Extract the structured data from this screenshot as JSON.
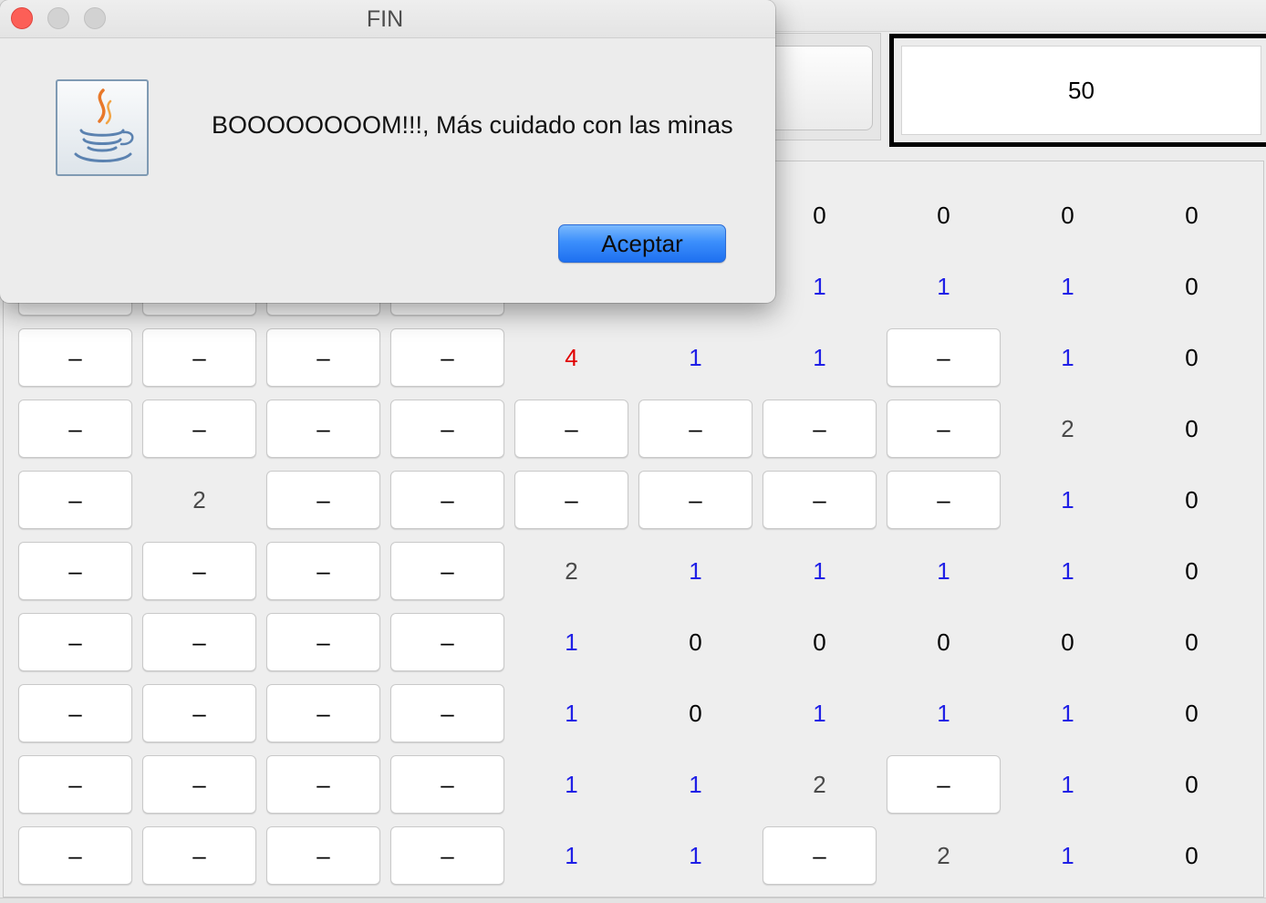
{
  "dialog": {
    "title": "FIN",
    "message": "BOOOOOOOOM!!!, Más cuidado con las minas",
    "ok_label": "Aceptar",
    "icon": "java-coffee-icon"
  },
  "header": {
    "counter": "50"
  },
  "colors": {
    "numbers": {
      "0": "#000000",
      "1": "#1f1fe6",
      "2": "#4a4a4a",
      "4": "#e00000"
    },
    "close_light": "#fc5f57",
    "accept_button": "#3c8ffc"
  },
  "board": {
    "rows": [
      [
        null,
        null,
        null,
        null,
        null,
        null,
        "0",
        "0",
        "0",
        "0"
      ],
      [
        {
          "covered": true
        },
        {
          "covered": true
        },
        {
          "covered": true
        },
        {
          "covered": true
        },
        null,
        null,
        "1",
        "1",
        "1",
        "0"
      ],
      [
        "–",
        "–",
        "–",
        "–",
        "4",
        "1",
        "1",
        "–",
        "1",
        "0"
      ],
      [
        "–",
        "–",
        "–",
        "–",
        "–",
        "–",
        "–",
        "–",
        "2",
        "0"
      ],
      [
        "–",
        "2",
        "–",
        "–",
        "–",
        "–",
        "–",
        "–",
        "1",
        "0"
      ],
      [
        "–",
        "–",
        "–",
        "–",
        "2",
        "1",
        "1",
        "1",
        "1",
        "0"
      ],
      [
        "–",
        "–",
        "–",
        "–",
        "1",
        "0",
        "0",
        "0",
        "0",
        "0"
      ],
      [
        "–",
        "–",
        "–",
        "–",
        "1",
        "0",
        "1",
        "1",
        "1",
        "0"
      ],
      [
        "–",
        "–",
        "–",
        "–",
        "1",
        "1",
        "2",
        "–",
        "1",
        "0"
      ],
      [
        "–",
        "–",
        "–",
        "–",
        "1",
        "1",
        "–",
        "2",
        "1",
        "0"
      ]
    ]
  }
}
